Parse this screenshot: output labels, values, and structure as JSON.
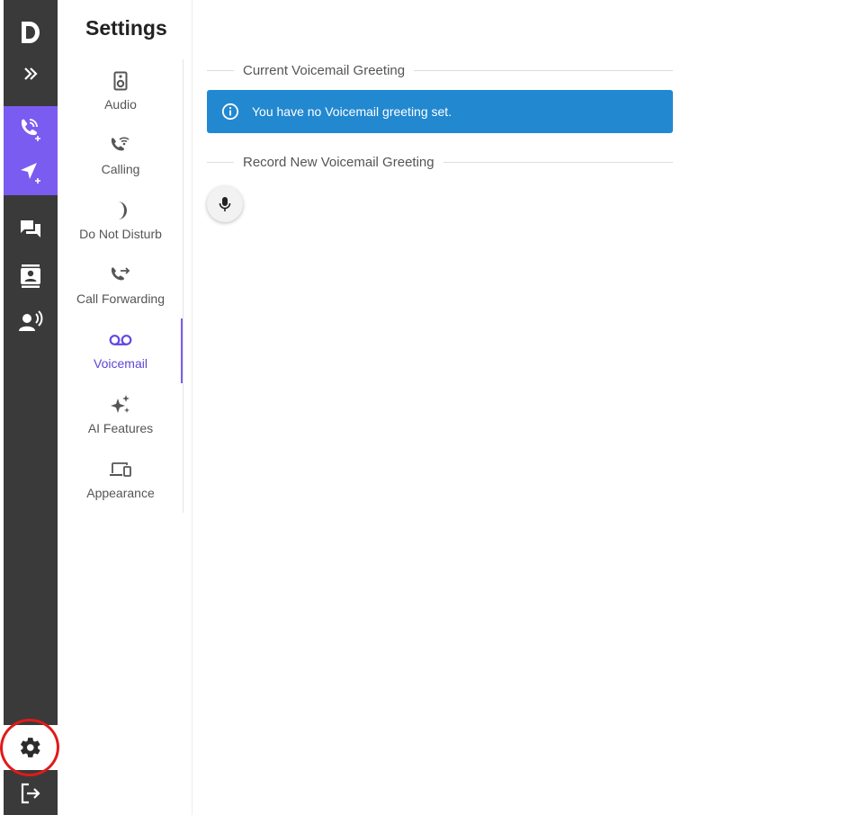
{
  "rail": {
    "logo_icon": "d-logo-icon",
    "expand_icon": "double-chevron-right-icon",
    "new_call_icon": "phone-plus-icon",
    "new_message_icon": "send-plus-icon",
    "messages_icon": "chat-bubbles-icon",
    "contacts_icon": "contact-card-icon",
    "voice_icon": "speaking-person-icon",
    "settings_icon": "gear-icon",
    "logout_icon": "logout-icon",
    "accent_color": "#7b5cf0",
    "background_color": "#3a3a3a",
    "highlight_color": "#e01a1a"
  },
  "settings": {
    "title": "Settings",
    "nav": [
      {
        "label": "Audio",
        "icon": "speaker-icon"
      },
      {
        "label": "Calling",
        "icon": "wifi-phone-icon"
      },
      {
        "label": "Do Not Disturb",
        "icon": "moon-icon"
      },
      {
        "label": "Call Forwarding",
        "icon": "phone-forward-icon"
      },
      {
        "label": "Voicemail",
        "icon": "voicemail-icon",
        "active": true
      },
      {
        "label": "AI Features",
        "icon": "sparkles-icon"
      },
      {
        "label": "Appearance",
        "icon": "devices-icon"
      }
    ]
  },
  "voicemail": {
    "current_heading": "Current Voicemail Greeting",
    "alert_text": "You have no Voicemail greeting set.",
    "alert_icon": "info-icon",
    "alert_color": "#2288d0",
    "record_heading": "Record New Voicemail Greeting",
    "record_icon": "microphone-icon"
  }
}
